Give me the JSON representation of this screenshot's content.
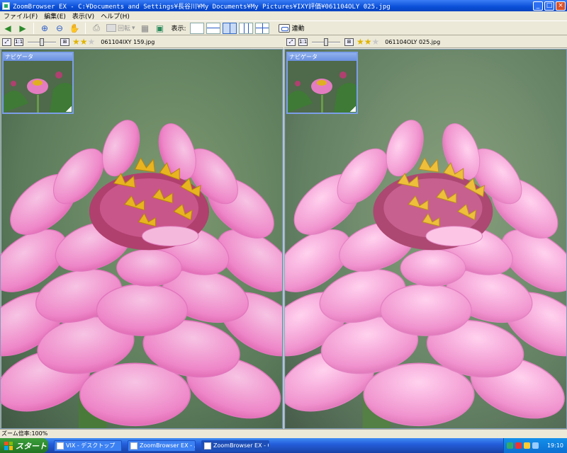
{
  "window": {
    "title": "ZoomBrowser EX - C:¥Documents and Settings¥長谷川¥My Documents¥My Pictures¥IXY評価¥061104OLY 025.jpg",
    "minimize": "_",
    "maximize": "□",
    "close": "×"
  },
  "menu": [
    "ファイル(F)",
    "編集(E)",
    "表示(V)",
    "ヘルプ(H)"
  ],
  "toolbar": {
    "rotate_label": "回転",
    "layout_label": "表示:",
    "sync_label": "連動"
  },
  "left_pane": {
    "filename": "061104IXY 159.jpg",
    "navigator_title": "ナビゲータ",
    "rating": 2,
    "rating_max": 3
  },
  "right_pane": {
    "filename": "061104OLY 025.jpg",
    "navigator_title": "ナビゲータ",
    "rating": 2,
    "rating_max": 3
  },
  "status": {
    "zoom": "ズーム倍率:100%"
  },
  "taskbar": {
    "start": "スタート",
    "tasks": [
      "VIX - デスクトップ",
      "ZoomBrowser EX - ...",
      "ZoomBrowser EX - C..."
    ],
    "clock": "19:10"
  },
  "colors": {
    "titlebar": "#0a4fd8",
    "taskbar": "#245edb",
    "start": "#2e8b2e",
    "star": "#e0b400"
  }
}
